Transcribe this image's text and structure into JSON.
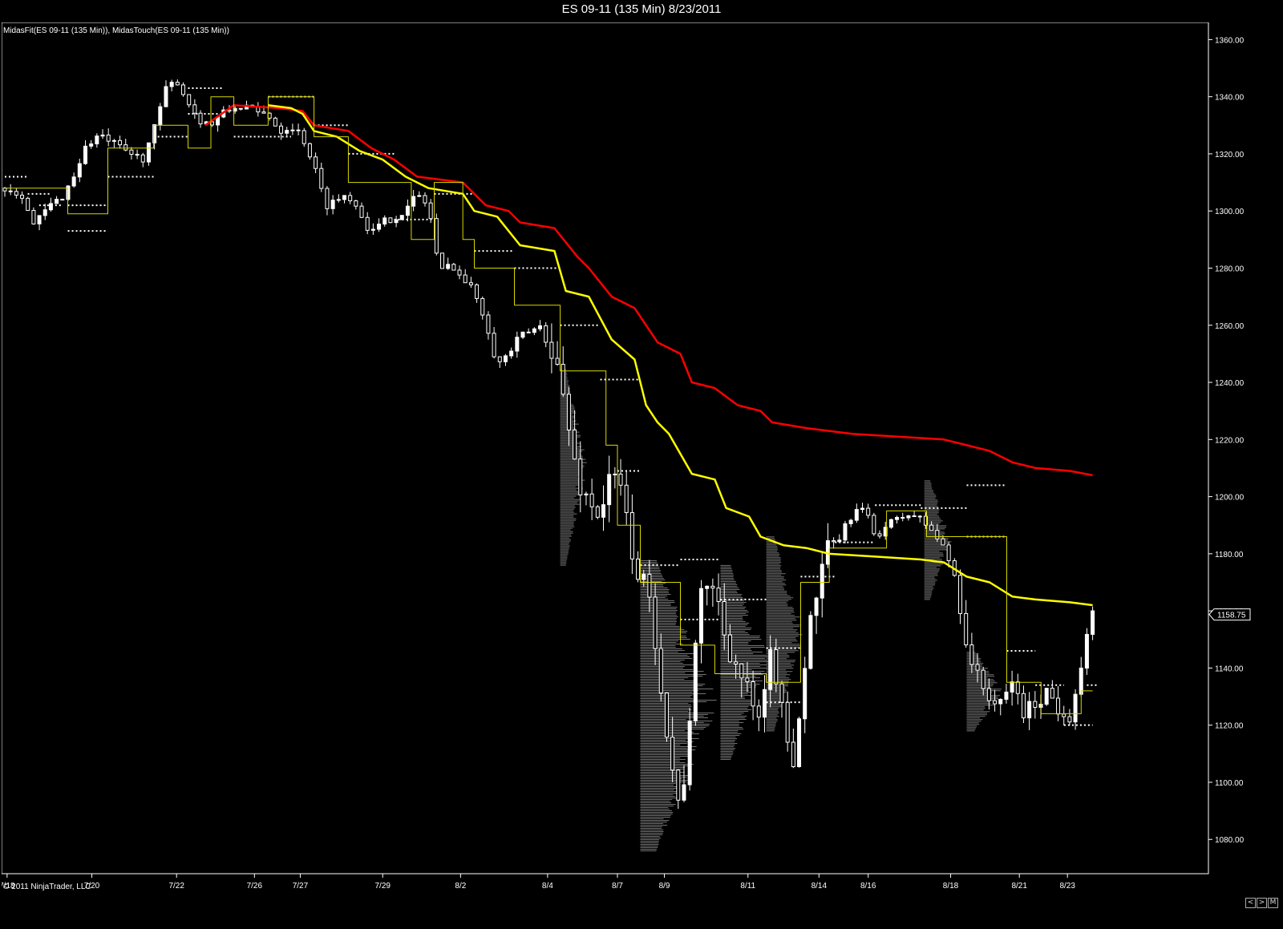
{
  "window": {
    "title": "ES 09-11 (135 Min)  8/23/2011",
    "indicators": "MidasFit(ES 09-11 (135 Min)), MidasTouch(ES 09-11 (135 Min))",
    "copyright": "© 2011 NinjaTrader, LLC",
    "scroll_buttons": [
      "<",
      ">",
      "M"
    ]
  },
  "colors": {
    "background": "#000000",
    "grid_frame": "#ffffff",
    "candle": "#ffffff",
    "midas_red": "#ff0000",
    "midas_yellow": "#ffff00",
    "touch_line": "#d8d800",
    "volume_profile": "#888888",
    "dotted_levels": "#ffffff"
  },
  "chart_data": {
    "type": "candlestick",
    "title": "ES 09-11 (135 Min)  8/23/2011",
    "ylim": [
      1068,
      1366
    ],
    "yticks": [
      1360,
      1340,
      1320,
      1300,
      1280,
      1260,
      1240,
      1220,
      1200,
      1180,
      1160,
      1140,
      1120,
      1100,
      1080
    ],
    "ytick_labels": [
      "1360.00",
      "1340.00",
      "1320.00",
      "1300.00",
      "1280.00",
      "1260.00",
      "1240.00",
      "1220.00",
      "1200.00",
      "1180.00",
      "1160.00",
      "1140.00",
      "1120.00",
      "1100.00",
      "1080.00"
    ],
    "xlim": [
      0,
      100
    ],
    "xticks": [
      {
        "x": 0.2,
        "label": "7/18"
      },
      {
        "x": 7.6,
        "label": "7/20"
      },
      {
        "x": 15.0,
        "label": "7/22"
      },
      {
        "x": 21.8,
        "label": "7/26"
      },
      {
        "x": 25.8,
        "label": "7/27"
      },
      {
        "x": 33.0,
        "label": "7/29"
      },
      {
        "x": 39.8,
        "label": "8/2"
      },
      {
        "x": 47.4,
        "label": "8/4"
      },
      {
        "x": 53.5,
        "label": "8/7"
      },
      {
        "x": 57.6,
        "label": "8/9"
      },
      {
        "x": 64.9,
        "label": "8/11"
      },
      {
        "x": 71.1,
        "label": "8/14"
      },
      {
        "x": 75.4,
        "label": "8/16"
      },
      {
        "x": 82.6,
        "label": "8/18"
      },
      {
        "x": 88.6,
        "label": "8/21"
      },
      {
        "x": 92.8,
        "label": "8/23"
      }
    ],
    "last_price_label": "1158.75",
    "last_price": 1158.75,
    "price_path": [
      [
        0,
        1308
      ],
      [
        1.5,
        1306
      ],
      [
        2.5,
        1295
      ],
      [
        4,
        1302
      ],
      [
        5,
        1305
      ],
      [
        6,
        1312
      ],
      [
        7,
        1322
      ],
      [
        8,
        1326
      ],
      [
        9,
        1325
      ],
      [
        10,
        1322
      ],
      [
        11,
        1320
      ],
      [
        12,
        1318
      ],
      [
        13,
        1328
      ],
      [
        14,
        1342
      ],
      [
        15,
        1346
      ],
      [
        16,
        1338
      ],
      [
        17,
        1332
      ],
      [
        18,
        1330
      ],
      [
        19,
        1334
      ],
      [
        20,
        1336
      ],
      [
        21,
        1337
      ],
      [
        22,
        1334
      ],
      [
        23,
        1334
      ],
      [
        24,
        1328
      ],
      [
        25,
        1330
      ],
      [
        26,
        1326
      ],
      [
        27,
        1316
      ],
      [
        28,
        1302
      ],
      [
        29,
        1304
      ],
      [
        30,
        1306
      ],
      [
        31,
        1300
      ],
      [
        32,
        1292
      ],
      [
        33,
        1296
      ],
      [
        34,
        1298
      ],
      [
        35,
        1300
      ],
      [
        36,
        1306
      ],
      [
        37,
        1302
      ],
      [
        38,
        1278
      ],
      [
        39,
        1282
      ],
      [
        40,
        1276
      ],
      [
        41,
        1272
      ],
      [
        42,
        1262
      ],
      [
        43,
        1246
      ],
      [
        44,
        1250
      ],
      [
        45,
        1256
      ],
      [
        46,
        1258
      ],
      [
        47,
        1260
      ],
      [
        48,
        1250
      ],
      [
        49,
        1230
      ],
      [
        50,
        1206
      ],
      [
        51,
        1198
      ],
      [
        52,
        1194
      ],
      [
        53,
        1208
      ],
      [
        54,
        1200
      ],
      [
        55,
        1176
      ],
      [
        56,
        1168
      ],
      [
        57,
        1146
      ],
      [
        58,
        1112
      ],
      [
        59,
        1088
      ],
      [
        60,
        1132
      ],
      [
        61,
        1172
      ],
      [
        62,
        1168
      ],
      [
        63,
        1150
      ],
      [
        64,
        1140
      ],
      [
        65,
        1130
      ],
      [
        66,
        1118
      ],
      [
        67,
        1148
      ],
      [
        68,
        1120
      ],
      [
        69,
        1108
      ],
      [
        70,
        1148
      ],
      [
        71,
        1168
      ],
      [
        72,
        1182
      ],
      [
        73,
        1186
      ],
      [
        74,
        1194
      ],
      [
        75,
        1196
      ],
      [
        76,
        1186
      ],
      [
        77,
        1190
      ],
      [
        78,
        1192
      ],
      [
        79,
        1194
      ],
      [
        80,
        1192
      ],
      [
        81,
        1188
      ],
      [
        82,
        1182
      ],
      [
        83,
        1172
      ],
      [
        84,
        1148
      ],
      [
        85,
        1136
      ],
      [
        86,
        1130
      ],
      [
        87,
        1126
      ],
      [
        88,
        1136
      ],
      [
        89,
        1124
      ],
      [
        90,
        1128
      ],
      [
        91,
        1132
      ],
      [
        92,
        1126
      ],
      [
        93,
        1124
      ],
      [
        94,
        1140
      ],
      [
        95,
        1158.75
      ]
    ],
    "series": [
      {
        "name": "MidasFit",
        "color": "#ff0000",
        "points": [
          [
            17.5,
            1330
          ],
          [
            20,
            1337
          ],
          [
            24,
            1336
          ],
          [
            26,
            1335
          ],
          [
            27,
            1330
          ],
          [
            30,
            1328
          ],
          [
            32,
            1322
          ],
          [
            34,
            1318
          ],
          [
            36,
            1312
          ],
          [
            40,
            1310
          ],
          [
            42,
            1302
          ],
          [
            44,
            1300
          ],
          [
            45,
            1296
          ],
          [
            48,
            1294
          ],
          [
            50,
            1284
          ],
          [
            51,
            1280
          ],
          [
            53,
            1270
          ],
          [
            55,
            1266
          ],
          [
            57,
            1254
          ],
          [
            59,
            1250
          ],
          [
            60,
            1240
          ],
          [
            62,
            1238
          ],
          [
            64,
            1232
          ],
          [
            66,
            1230
          ],
          [
            67,
            1226
          ],
          [
            70,
            1224
          ],
          [
            74,
            1222
          ],
          [
            78,
            1221
          ],
          [
            82,
            1220
          ],
          [
            84,
            1218
          ],
          [
            86,
            1216
          ],
          [
            88,
            1212
          ],
          [
            90,
            1210
          ],
          [
            93,
            1209
          ],
          [
            95,
            1207.5
          ]
        ]
      },
      {
        "name": "MidasTouch",
        "color": "#ffff00",
        "points": [
          [
            23,
            1337
          ],
          [
            25,
            1336
          ],
          [
            26,
            1334
          ],
          [
            27,
            1328
          ],
          [
            29,
            1326
          ],
          [
            31,
            1321
          ],
          [
            33,
            1318
          ],
          [
            35,
            1312
          ],
          [
            37,
            1308
          ],
          [
            40,
            1306
          ],
          [
            41,
            1300
          ],
          [
            43,
            1298
          ],
          [
            45,
            1288
          ],
          [
            48,
            1286
          ],
          [
            49,
            1272
          ],
          [
            51,
            1270
          ],
          [
            53,
            1255
          ],
          [
            55,
            1248
          ],
          [
            56,
            1232
          ],
          [
            57,
            1226
          ],
          [
            58,
            1222
          ],
          [
            60,
            1208
          ],
          [
            62,
            1206
          ],
          [
            63,
            1196
          ],
          [
            65,
            1193
          ],
          [
            66,
            1186
          ],
          [
            68,
            1183
          ],
          [
            70,
            1182
          ],
          [
            72,
            1180
          ],
          [
            76,
            1179
          ],
          [
            80,
            1178
          ],
          [
            82,
            1177
          ],
          [
            84,
            1172
          ],
          [
            86,
            1170
          ],
          [
            88,
            1165
          ],
          [
            90,
            1164
          ],
          [
            93,
            1163
          ],
          [
            95,
            1162
          ]
        ]
      },
      {
        "name": "MidasTouch step",
        "color": "#d8d800",
        "points": [
          [
            0,
            1308
          ],
          [
            5.5,
            1308
          ],
          [
            5.5,
            1299
          ],
          [
            9,
            1299
          ],
          [
            9,
            1322
          ],
          [
            13,
            1322
          ],
          [
            13,
            1330
          ],
          [
            16,
            1330
          ],
          [
            16,
            1322
          ],
          [
            18,
            1322
          ],
          [
            18,
            1340
          ],
          [
            20,
            1340
          ],
          [
            20,
            1330
          ],
          [
            23,
            1330
          ],
          [
            23,
            1340
          ],
          [
            27,
            1340
          ],
          [
            27,
            1326
          ],
          [
            30,
            1326
          ],
          [
            30,
            1310
          ],
          [
            34,
            1310
          ],
          [
            34,
            1310
          ],
          [
            35.5,
            1310
          ],
          [
            35.5,
            1290
          ],
          [
            37.5,
            1290
          ],
          [
            37.5,
            1310
          ],
          [
            40,
            1310
          ],
          [
            40,
            1290
          ],
          [
            41,
            1290
          ],
          [
            41,
            1280
          ],
          [
            44.5,
            1280
          ],
          [
            44.5,
            1267
          ],
          [
            48.5,
            1267
          ],
          [
            48.5,
            1244
          ],
          [
            52.5,
            1244
          ],
          [
            52.5,
            1218
          ],
          [
            53.5,
            1218
          ],
          [
            53.5,
            1190
          ],
          [
            55.5,
            1190
          ],
          [
            55.5,
            1170
          ],
          [
            59,
            1170
          ],
          [
            59,
            1148
          ],
          [
            62,
            1148
          ],
          [
            62,
            1138
          ],
          [
            66.5,
            1138
          ],
          [
            66.5,
            1135
          ],
          [
            69.5,
            1135
          ],
          [
            69.5,
            1170
          ],
          [
            72,
            1170
          ],
          [
            72,
            1182
          ],
          [
            77,
            1182
          ],
          [
            77,
            1195
          ],
          [
            80.5,
            1195
          ],
          [
            80.5,
            1186
          ],
          [
            87.5,
            1186
          ],
          [
            87.5,
            1135
          ],
          [
            90.5,
            1135
          ],
          [
            90.5,
            1124
          ],
          [
            94,
            1124
          ],
          [
            94,
            1132
          ],
          [
            95,
            1132
          ]
        ]
      }
    ],
    "volume_profile_zones": [
      {
        "x_start": 48.5,
        "price_low": 1176,
        "price_high": 1245,
        "max_width": 2.5
      },
      {
        "x_start": 55.5,
        "price_low": 1076,
        "price_high": 1178,
        "max_width": 7.0
      },
      {
        "x_start": 62.5,
        "price_low": 1108,
        "price_high": 1176,
        "max_width": 4.5
      },
      {
        "x_start": 66.5,
        "price_low": 1118,
        "price_high": 1186,
        "max_width": 3.5
      },
      {
        "x_start": 80.3,
        "price_low": 1164,
        "price_high": 1206,
        "max_width": 2.5
      },
      {
        "x_start": 84.0,
        "price_low": 1118,
        "price_high": 1146,
        "max_width": 3.5
      }
    ],
    "dotted_levels": [
      [
        0,
        2,
        1312
      ],
      [
        2,
        4,
        1306
      ],
      [
        3,
        5,
        1302
      ],
      [
        5.5,
        9,
        1302
      ],
      [
        5.5,
        9,
        1293
      ],
      [
        9,
        13,
        1312
      ],
      [
        13,
        16,
        1326
      ],
      [
        16,
        19,
        1343
      ],
      [
        16,
        19,
        1334
      ],
      [
        20,
        25,
        1326
      ],
      [
        23,
        27,
        1340
      ],
      [
        27,
        30,
        1330
      ],
      [
        30,
        34,
        1320
      ],
      [
        34,
        37.5,
        1297
      ],
      [
        37.5,
        41,
        1306
      ],
      [
        41,
        44.5,
        1286
      ],
      [
        44.5,
        48.5,
        1280
      ],
      [
        48.5,
        52,
        1260
      ],
      [
        52,
        55.5,
        1241
      ],
      [
        53.5,
        55.5,
        1209
      ],
      [
        55.5,
        59,
        1176
      ],
      [
        59,
        62.5,
        1178
      ],
      [
        59,
        62.5,
        1157
      ],
      [
        62.5,
        66.5,
        1164
      ],
      [
        66.5,
        69.5,
        1147
      ],
      [
        66.5,
        69.5,
        1128
      ],
      [
        69.5,
        72.5,
        1172
      ],
      [
        72.5,
        76,
        1184
      ],
      [
        76,
        80,
        1197
      ],
      [
        80,
        84,
        1196
      ],
      [
        84,
        87.5,
        1204
      ],
      [
        84,
        87.5,
        1186
      ],
      [
        87.5,
        90,
        1146
      ],
      [
        90,
        92.5,
        1134
      ],
      [
        92.5,
        95,
        1120
      ],
      [
        94.5,
        95.5,
        1134
      ]
    ]
  }
}
